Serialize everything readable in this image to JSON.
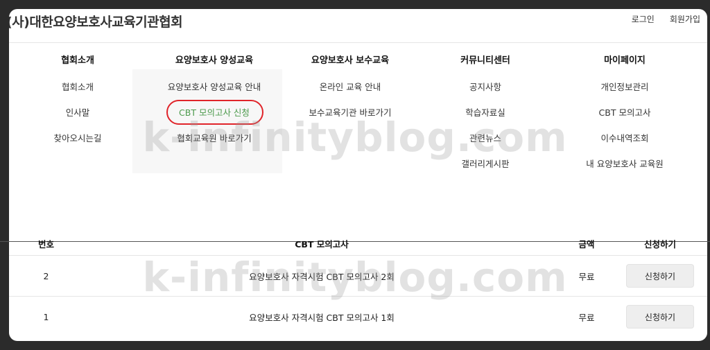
{
  "header": {
    "title": "(사)대한요양보호사교육기관협회",
    "login": "로그인",
    "signup": "회원가입"
  },
  "menu": [
    {
      "heading": "협회소개",
      "items": [
        "협회소개",
        "인사말",
        "찾아오시는길"
      ]
    },
    {
      "heading": "요양보호사 양성교육",
      "items": [
        "요양보호사 양성교육 안내",
        "CBT 모의고사 신청",
        "협회교육원 바로가기"
      ]
    },
    {
      "heading": "요양보호사 보수교육",
      "items": [
        "온라인 교육 안내",
        "보수교육기관 바로가기"
      ]
    },
    {
      "heading": "커뮤니티센터",
      "items": [
        "공지사항",
        "학습자료실",
        "관련뉴스",
        "갤러리게시판"
      ]
    },
    {
      "heading": "마이페이지",
      "items": [
        "개인정보관리",
        "CBT 모의고사",
        "이수내역조회",
        "내 요양보호사 교육원"
      ]
    }
  ],
  "table": {
    "headers": [
      "번호",
      "CBT 모의고사",
      "금액",
      "신청하기"
    ],
    "rows": [
      {
        "no": "2",
        "title": "요양보호사 자격시험 CBT 모의고사 2회",
        "price": "무료",
        "action": "신청하기"
      },
      {
        "no": "1",
        "title": "요양보호사 자격시험 CBT 모의고사 1회",
        "price": "무료",
        "action": "신청하기"
      }
    ]
  },
  "watermark": "k-infinityblog.com",
  "colors": {
    "highlight_circle": "#e0242a",
    "active_link": "#4c9a4c"
  }
}
